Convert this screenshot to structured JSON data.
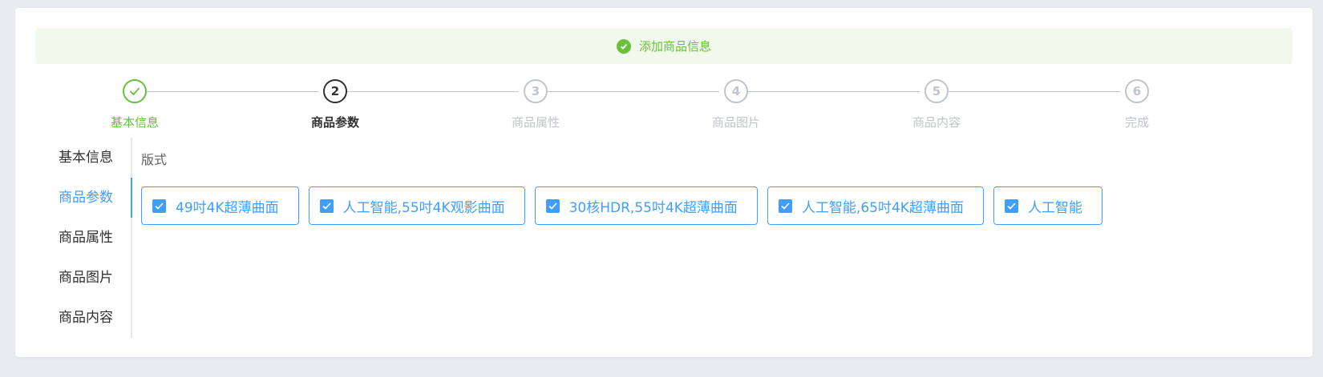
{
  "alert": {
    "text": "添加商品信息",
    "color": "#67c23a",
    "icon": "check-circle-icon"
  },
  "steps": [
    {
      "number": "1",
      "label": "基本信息",
      "state": "done"
    },
    {
      "number": "2",
      "label": "商品参数",
      "state": "active"
    },
    {
      "number": "3",
      "label": "商品属性",
      "state": "wait"
    },
    {
      "number": "4",
      "label": "商品图片",
      "state": "wait"
    },
    {
      "number": "5",
      "label": "商品内容",
      "state": "wait"
    },
    {
      "number": "6",
      "label": "完成",
      "state": "wait"
    }
  ],
  "tabs": [
    {
      "label": "基本信息",
      "active": false
    },
    {
      "label": "商品参数",
      "active": true
    },
    {
      "label": "商品属性",
      "active": false
    },
    {
      "label": "商品图片",
      "active": false
    },
    {
      "label": "商品内容",
      "active": false
    }
  ],
  "param": {
    "title": "版式",
    "options": [
      {
        "label": "49吋4K超薄曲面",
        "checked": true
      },
      {
        "label": "人工智能,55吋4K观影曲面",
        "checked": true
      },
      {
        "label": "30核HDR,55吋4K超薄曲面",
        "checked": true
      },
      {
        "label": "人工智能,65吋4K超薄曲面",
        "checked": true
      },
      {
        "label": "人工智能",
        "checked": true
      }
    ]
  },
  "colors": {
    "primary": "#409eff",
    "success": "#67c23a",
    "muted": "#c0c4cc",
    "text": "#303133"
  }
}
